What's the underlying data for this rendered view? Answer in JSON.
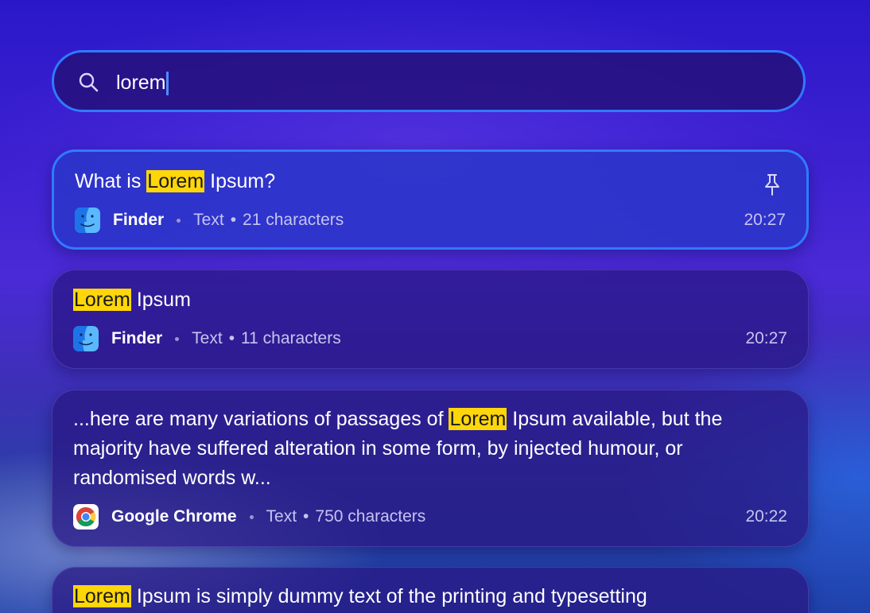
{
  "search": {
    "query": "lorem",
    "icon": "search-icon"
  },
  "results": [
    {
      "title_before": "What is ",
      "title_highlight": "Lorem",
      "title_after": " Ipsum?",
      "app": "Finder",
      "type": "Text",
      "count": "21 characters",
      "time": "20:27",
      "pinned_icon": "pin-icon",
      "selected": true
    },
    {
      "title_before": "",
      "title_highlight": "Lorem",
      "title_after": " Ipsum",
      "app": "Finder",
      "type": "Text",
      "count": "11 characters",
      "time": "20:27",
      "selected": false
    },
    {
      "title_before": "...here are many variations of passages of ",
      "title_highlight": "Lorem",
      "title_after": " Ipsum available, but the majority have suffered alteration in some form, by injected humour, or randomised words w...",
      "app": "Google Chrome",
      "type": "Text",
      "count": "750 characters",
      "time": "20:22",
      "selected": false
    },
    {
      "title_before": "",
      "title_highlight": "Lorem",
      "title_after": " Ipsum is simply dummy text of the printing and typesetting",
      "selected": false
    }
  ],
  "colors": {
    "accent": "#2f7bff",
    "highlight": "#ffd60a",
    "card": "#28167f",
    "card_selected": "#2837c8"
  }
}
